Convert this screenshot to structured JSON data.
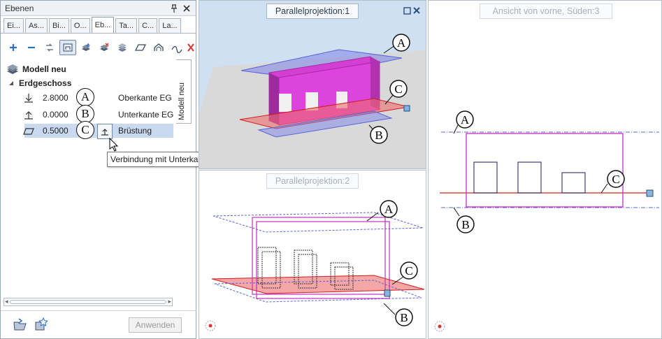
{
  "panel": {
    "title": "Ebenen",
    "tabs": [
      "Ei...",
      "As...",
      "Bi...",
      "O...",
      "Eb...",
      "Ta...",
      "C...",
      "La..."
    ],
    "active_tab": 4,
    "vertical_tab": "Modell neu",
    "tree": {
      "model": "Modell neu",
      "floor": "Erdgeschoss",
      "levels": [
        {
          "value": "2.8000",
          "letter": "A",
          "name": "Oberkante EG"
        },
        {
          "value": "0.0000",
          "letter": "B",
          "name": "Unterkante EG"
        },
        {
          "value": "0.5000",
          "letter": "C",
          "name": "Brüstung"
        }
      ]
    },
    "tooltip": "Verbindung mit Unterkante",
    "apply_button": "Anwenden"
  },
  "views": {
    "v1": {
      "title": "Parallelprojektion:1"
    },
    "v2": {
      "title": "Parallelprojektion:2"
    },
    "v3": {
      "title": "Ansicht von vorne, Süden:3"
    }
  },
  "labels": {
    "a": "A",
    "b": "B",
    "c": "C"
  },
  "colors": {
    "accent": "#c22ec2",
    "plane_blue": "#6f7fe0",
    "plane_red": "#e03a3a",
    "selection": "#c9daf0"
  }
}
